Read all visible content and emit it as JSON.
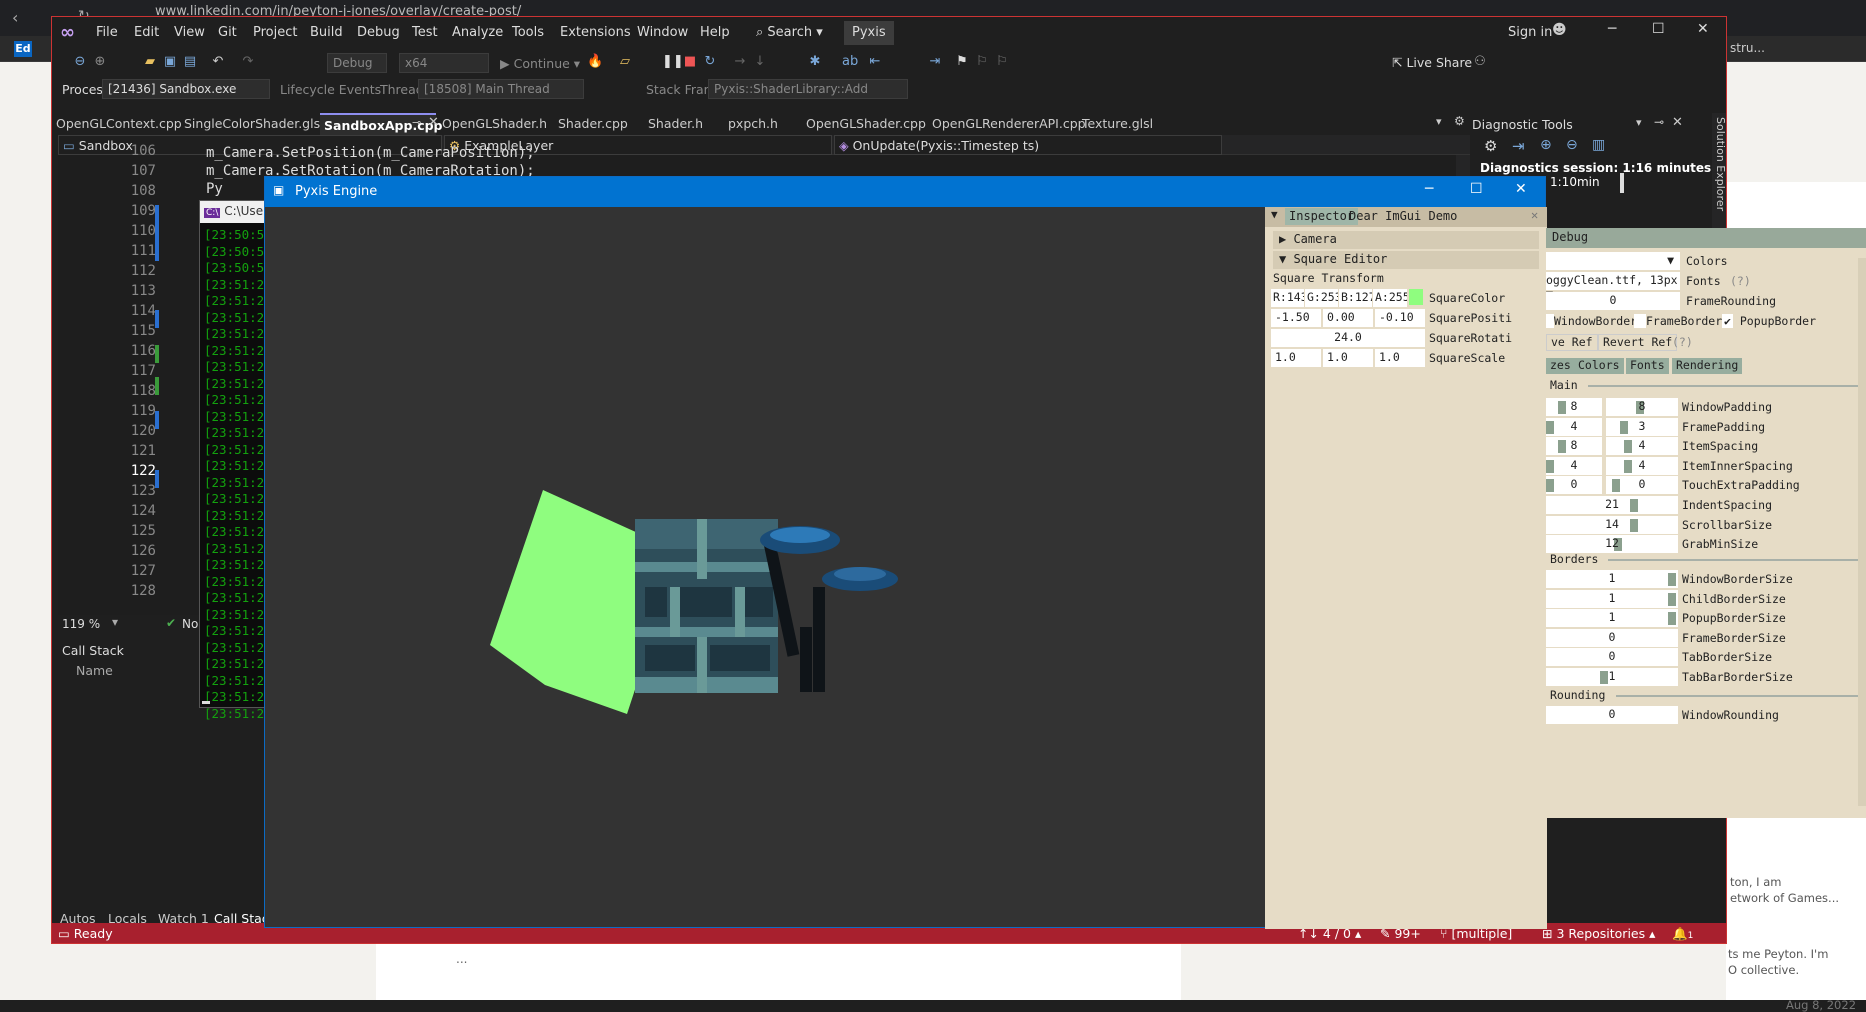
{
  "browser": {
    "url": "www.linkedin.com/in/peyton-j-jones/overlay/create-post/",
    "bookmark_left": "Ed",
    "bookmark_right": "stru...",
    "behind_texts": [
      "ts me Peyton. I'm",
      "O collective.",
      "Aug 8, 2022",
      "ton, I am",
      "etwork of Games..."
    ],
    "bottom_ellipsis": "..."
  },
  "vs": {
    "menu": [
      "File",
      "Edit",
      "View",
      "Git",
      "Project",
      "Build",
      "Debug",
      "Test",
      "Analyze",
      "Tools",
      "Extensions",
      "Window",
      "Help"
    ],
    "search_label": "Search",
    "solution_name": "Pyxis",
    "sign_in": "Sign in",
    "live_share": "Live Share",
    "toolbar": {
      "config": "Debug",
      "platform": "x64",
      "continue": "Continue"
    },
    "debug_bar": {
      "process_label": "Process:",
      "process_value": "[21436] Sandbox.exe",
      "lifecycle": "Lifecycle Events",
      "thread_label": "Thread:",
      "thread_value": "[18508] Main Thread",
      "stack_label": "Stack Frame:",
      "stack_value": "Pyxis::ShaderLibrary::Add"
    },
    "tabs": [
      "OpenGLContext.cpp",
      "SingleColorShader.glsl",
      "SandboxApp.cpp",
      "OpenGLShader.h",
      "Shader.cpp",
      "Shader.h",
      "pxpch.h",
      "OpenGLShader.cpp",
      "OpenGLRendererAPI.cpp",
      "Texture.glsl"
    ],
    "active_tab": "SandboxApp.cpp",
    "nav": {
      "project": "Sandbox",
      "scope": "ExampleLayer",
      "member": "OnUpdate(Pyxis::Timestep ts)"
    },
    "code_lines": [
      "m_Camera.SetPosition(m_CameraPosition);",
      "m_Camera.SetRotation(m_CameraRotation);",
      "Py"
    ],
    "line_numbers": [
      "106",
      "107",
      "108",
      "109",
      "110",
      "111",
      "112",
      "113",
      "114",
      "115",
      "116",
      "117",
      "118",
      "119",
      "120",
      "121",
      "122",
      "123",
      "124",
      "125",
      "126",
      "127",
      "128"
    ],
    "current_line": "122",
    "zoom": "119 %",
    "issues": "No is",
    "callstack_title": "Call Stack",
    "callstack_col": "Name",
    "bottom_tabs": [
      "Autos",
      "Locals",
      "Watch 1",
      "Call Stack"
    ],
    "status": {
      "ready": "Ready",
      "lines": "4 / 0",
      "pct": "99+",
      "branch": "[multiple]",
      "repos": "3 Repositories",
      "notif": "1"
    },
    "diag": {
      "title": "Diagnostic Tools",
      "session": "Diagnostics session: 1:16 minutes",
      "timeline": "1:10min"
    },
    "solution_explorer": "Solution Explorer"
  },
  "console": {
    "title": "C:\\Use",
    "lines": [
      "[23:50:5",
      "[23:50:5",
      "[23:50:5",
      "[23:51:2",
      "[23:51:2",
      "[23:51:2",
      "[23:51:2",
      "[23:51:2",
      "[23:51:2",
      "[23:51:2",
      "[23:51:2",
      "[23:51:2",
      "[23:51:2",
      "[23:51:2",
      "[23:51:2",
      "[23:51:2",
      "[23:51:2",
      "[23:51:2",
      "[23:51:2",
      "[23:51:2",
      "[23:51:2",
      "[23:51:2",
      "[23:51:2",
      "[23:51:2",
      "[23:51:2",
      "[23:51:2",
      "[23:51:2",
      "[23:51:2",
      "[23:51:2",
      "[23:51:2"
    ]
  },
  "engine": {
    "title": "Pyxis Engine",
    "square_color": "#8ffd7f"
  },
  "inspector": {
    "tabs": [
      "Inspector",
      "Dear ImGui Demo"
    ],
    "camera": "Camera",
    "square_editor": "Square Editor",
    "transform": "Square Transform",
    "color": {
      "r": "R:143",
      "g": "G:253",
      "b": "B:127",
      "a": "A:255",
      "label": "SquareColor"
    },
    "position": {
      "x": "-1.50",
      "y": "0.00",
      "z": "-0.10",
      "label": "SquarePositi"
    },
    "rotation": {
      "value": "24.0",
      "label": "SquareRotati"
    },
    "scale": {
      "x": "1.0",
      "y": "1.0",
      "z": "1.0",
      "label": "SquareScale"
    }
  },
  "debug_window": {
    "title": "Debug",
    "colors_label": "Colors",
    "font_value": "oggyClean.ttf, 13px",
    "fonts_label": "Fonts",
    "help": "(?)",
    "frame_rounding_val": "0",
    "frame_rounding": "FrameRounding",
    "window_border": "WindowBorder",
    "frame_border": "FrameBorder",
    "popup_border": "PopupBorder",
    "save_ref": "ve Ref",
    "revert_ref": "Revert Ref",
    "tabs": [
      "zes",
      "Colors",
      "Fonts",
      "Rendering"
    ],
    "main": "Main",
    "rows": [
      {
        "a": "8",
        "b": "8",
        "label": "WindowPadding"
      },
      {
        "a": "4",
        "b": "3",
        "label": "FramePadding"
      },
      {
        "a": "8",
        "b": "4",
        "label": "ItemSpacing"
      },
      {
        "a": "4",
        "b": "4",
        "label": "ItemInnerSpacing"
      },
      {
        "a": "0",
        "b": "0",
        "label": "TouchExtraPadding"
      }
    ],
    "single_rows": [
      {
        "v": "21",
        "label": "IndentSpacing"
      },
      {
        "v": "14",
        "label": "ScrollbarSize"
      },
      {
        "v": "12",
        "label": "GrabMinSize"
      }
    ],
    "borders": "Borders",
    "border_rows": [
      {
        "v": "1",
        "label": "WindowBorderSize"
      },
      {
        "v": "1",
        "label": "ChildBorderSize"
      },
      {
        "v": "1",
        "label": "PopupBorderSize"
      },
      {
        "v": "0",
        "label": "FrameBorderSize"
      },
      {
        "v": "0",
        "label": "TabBorderSize"
      },
      {
        "v": "1",
        "label": "TabBarBorderSize"
      }
    ],
    "rounding": "Rounding",
    "rounding_rows": [
      {
        "v": "0",
        "label": "WindowRounding"
      }
    ]
  }
}
